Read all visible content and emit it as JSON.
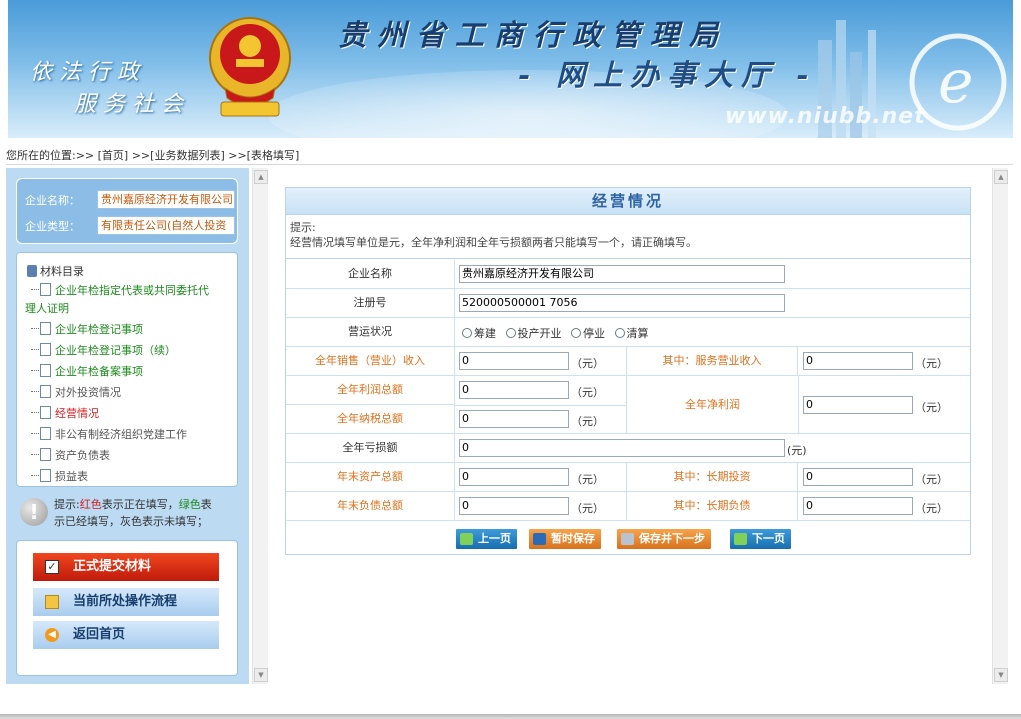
{
  "header": {
    "slogan_line1": "依法行政",
    "slogan_line2": "服务社会",
    "title_line1": "贵州省工商行政管理局",
    "title_line2": "- 网上办事大厅 -",
    "watermark": "www.niubb.net",
    "emblem_icon": "emblem-icon",
    "emblem_text": "工商行政管理"
  },
  "breadcrumb": "您所在的位置:>> [首页] >>[业务数据列表] >>[表格填写]",
  "company": {
    "name_label": "企业名称：",
    "name_value": "贵州嘉原经济开发有限公司",
    "type_label": "企业类型：",
    "type_value": "有限责任公司(自然人投资"
  },
  "menu": {
    "root_label": "材料目录",
    "items": [
      {
        "label": "企业年检指定代表或共同委托代",
        "label2": "理人证明",
        "state": "done"
      },
      {
        "label": "企业年检登记事项",
        "state": "done"
      },
      {
        "label": "企业年检登记事项（续）",
        "state": "done"
      },
      {
        "label": "企业年检备案事项",
        "state": "done"
      },
      {
        "label": "对外投资情况",
        "state": "todo"
      },
      {
        "label": "经营情况",
        "state": "current"
      },
      {
        "label": "非公有制经济组织党建工作",
        "state": "todo"
      },
      {
        "label": "资产负债表",
        "state": "todo"
      },
      {
        "label": "损益表",
        "state": "todo"
      }
    ]
  },
  "tip": {
    "prefix": "提示:",
    "red": "红色",
    "mid": "表示正在填写，",
    "green": "绿色",
    "tail1": "表",
    "tail2": "示已经填写，灰色表示未填写；"
  },
  "actions": {
    "submit": "正式提交材料",
    "flow": "当前所处操作流程",
    "home": "返回首页"
  },
  "form": {
    "title": "经营情况",
    "hint_line1": "提示:",
    "hint_line2": "经营情况填写单位是元，全年净利润和全年亏损额两者只能填写一个，请正确填写。",
    "company_name_label": "企业名称",
    "company_name_value": "贵州嘉原经济开发有限公司",
    "reg_no_label": "注册号",
    "reg_no_value": "520000500001 7056",
    "status_label": "营运状况",
    "status_options": [
      "筹建",
      "投产开业",
      "停业",
      "清算"
    ],
    "unit": "（元）",
    "unit_short": "(元)",
    "sales_label": "全年销售（营业）收入",
    "sales_value": "0",
    "service_label": "其中：服务营业收入",
    "service_value": "0",
    "profit_total_label": "全年利润总额",
    "profit_total_value": "0",
    "tax_total_label": "全年纳税总额",
    "tax_total_value": "0",
    "net_profit_label": "全年净利润",
    "net_profit_value": "0",
    "loss_label": "全年亏损额",
    "loss_value": "0",
    "assets_label": "年末资产总额",
    "assets_value": "0",
    "long_invest_label": "其中：长期投资",
    "long_invest_value": "0",
    "liabilities_label": "年末负债总额",
    "liabilities_value": "0",
    "long_liab_label": "其中：长期负债",
    "long_liab_value": "0"
  },
  "buttons": {
    "prev": "上一页",
    "temp_save": "暂时保存",
    "save_next": "保存并下一步",
    "next": "下一页"
  }
}
